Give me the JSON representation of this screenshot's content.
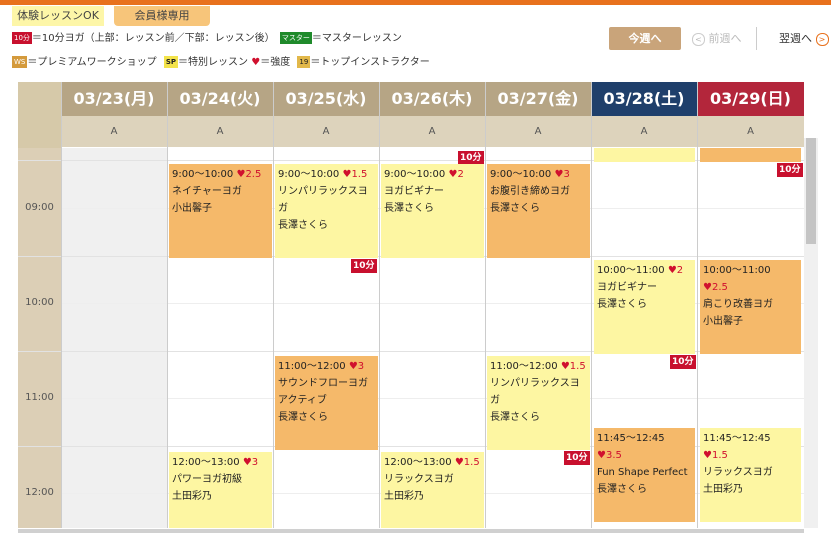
{
  "tabs": {
    "trial": "体験レッスンOK",
    "member": "会員様専用"
  },
  "legend": {
    "badge_10min": "10分",
    "text_10min": "＝10分ヨガ（上部：レッスン前／下部：レッスン後）",
    "badge_master": "マスター",
    "text_master": "＝マスターレッスン",
    "badge_ws": "WS",
    "text_ws": "＝プレミアムワークショップ",
    "badge_sp": "SP",
    "text_sp": "＝特別レッスン",
    "heart": "♥",
    "text_heart": "＝強度",
    "badge_crown": "19",
    "text_crown": "＝トップインストラクター"
  },
  "nav": {
    "this_week": "今週へ",
    "prev_icon": "<",
    "prev_week": "前週へ",
    "next_week": "翌週へ",
    "next_icon": ">"
  },
  "colors": {
    "accent": "#e8711d",
    "weekday_header": "#b6a585",
    "saturday_header": "#1f3f6b",
    "sunday_header": "#b3263b",
    "yellow_block": "#fdf6a2",
    "orange_block": "#f5b96a",
    "ten_min_tag": "#c8102e"
  },
  "days": [
    {
      "label": "03/23(月)",
      "studio": "A"
    },
    {
      "label": "03/24(火)",
      "studio": "A"
    },
    {
      "label": "03/25(水)",
      "studio": "A"
    },
    {
      "label": "03/26(木)",
      "studio": "A"
    },
    {
      "label": "03/27(金)",
      "studio": "A"
    },
    {
      "label": "03/28(土)",
      "studio": "A"
    },
    {
      "label": "03/29(日)",
      "studio": "A"
    }
  ],
  "hours": [
    "09:00",
    "10:00",
    "11:00",
    "12:00"
  ],
  "ten_min_label": "10分",
  "lessons": {
    "tue_0900": {
      "time": "9:00〜10:00",
      "intensity": "2.5",
      "name": "ネイチャーヨガ",
      "teacher": "小出馨子"
    },
    "wed_0900": {
      "time": "9:00〜10:00",
      "intensity": "1.5",
      "name": "リンパリラックスヨガ",
      "teacher": "長澤さくら"
    },
    "thu_0900": {
      "time": "9:00〜10:00",
      "intensity": "2",
      "name": "ヨガビギナー",
      "teacher": "長澤さくら"
    },
    "fri_0900": {
      "time": "9:00〜10:00",
      "intensity": "3",
      "name": "お腹引き締めヨガ",
      "teacher": "長澤さくら"
    },
    "sat_1000": {
      "time": "10:00〜11:00",
      "intensity": "2",
      "name": "ヨガビギナー",
      "teacher": "長澤さくら"
    },
    "sun_1000": {
      "time": "10:00〜11:00",
      "intensity": "2.5",
      "name": "肩こり改善ヨガ",
      "teacher": "小出馨子"
    },
    "wed_1100": {
      "time": "11:00〜12:00",
      "intensity": "3",
      "name": "サウンドフローヨガ　アクティブ",
      "teacher": "長澤さくら"
    },
    "fri_1100": {
      "time": "11:00〜12:00",
      "intensity": "1.5",
      "name": "リンパリラックスヨガ",
      "teacher": "長澤さくら"
    },
    "sat_1145": {
      "time": "11:45〜12:45",
      "intensity": "3.5",
      "name": "Fun Shape Perfect",
      "teacher": "長澤さくら"
    },
    "sun_1145": {
      "time": "11:45〜12:45",
      "intensity": "1.5",
      "name": "リラックスヨガ",
      "teacher": "土田彩乃"
    },
    "tue_1200": {
      "time": "12:00〜13:00",
      "intensity": "3",
      "name": "パワーヨガ初級",
      "teacher": "土田彩乃"
    },
    "thu_1200": {
      "time": "12:00〜13:00",
      "intensity": "1.5",
      "name": "リラックスヨガ",
      "teacher": "土田彩乃"
    }
  }
}
